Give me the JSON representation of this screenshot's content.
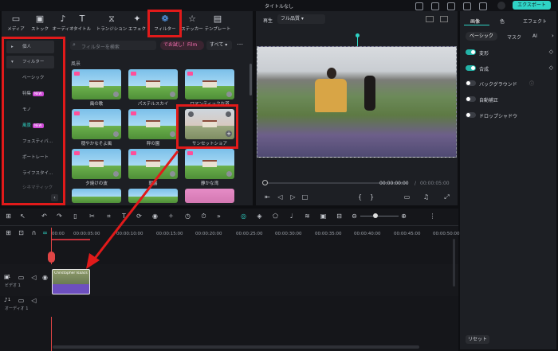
{
  "window": {
    "title": "タイトルなし",
    "export_label": "エクスポート"
  },
  "toolbar": {
    "tabs": [
      "メディア",
      "ストック",
      "オーディオ",
      "タイトル",
      "トランジション",
      "エフェク",
      "フィルター",
      "ステッカー",
      "テンプレート"
    ]
  },
  "sidebar": {
    "items": [
      {
        "label": "個人",
        "expanded": false
      },
      {
        "label": "フィルター",
        "expanded": true
      },
      {
        "label": "ベーシック"
      },
      {
        "label": "特集",
        "badge": "NEW"
      },
      {
        "label": "モノ"
      },
      {
        "label": "風景",
        "badge": "NEW"
      },
      {
        "label": "フェスティバ…"
      },
      {
        "label": "ポートレート"
      },
      {
        "label": "ライフスタイ…"
      },
      {
        "label": "シネマティック"
      }
    ]
  },
  "filter_browser": {
    "search_placeholder": "フィルターを検索",
    "try_button": "でお試し！Film",
    "category_select": "すべて",
    "section_label": "風景",
    "filters": [
      "風の歌",
      "パステルスカイ",
      "ロマンティックな道",
      "穏やかなそよ風",
      "秤の園",
      "サンセットショア",
      "夕焼けの波",
      "朝露",
      "静かな湾"
    ]
  },
  "preview": {
    "tab_label": "再生",
    "quality": "フル品質",
    "time_current": "00:00:00:00",
    "time_separator": "/",
    "time_total": "00:00:05:00"
  },
  "properties": {
    "tabs": [
      "画像",
      "色",
      "エフェクト"
    ],
    "subtabs": [
      "ベーシック",
      "マスク",
      "AI"
    ],
    "rows": [
      {
        "label": "変形",
        "on": true
      },
      {
        "label": "合成",
        "on": true
      },
      {
        "label": "バックグラウンド",
        "on": false
      },
      {
        "label": "自動補正",
        "on": false
      },
      {
        "label": "ドロップシャドウ",
        "on": false
      }
    ],
    "reset_label": "リセット"
  },
  "timeline": {
    "ruler": [
      "00:00",
      "00:00:05:00",
      "00:00:10:00",
      "00:00:15:00",
      "00:00:20:00",
      "00:00:25:00",
      "00:00:30:00",
      "00:00:35:00",
      "00:00:40:00",
      "00:00:45:00",
      "00:00:50:00"
    ],
    "video_track_label": "ビデオ 1",
    "audio_track_label": "オーディオ 1",
    "clip_label": "Christopher Isaacs",
    "video_track_num": "1",
    "audio_track_num": "1"
  }
}
